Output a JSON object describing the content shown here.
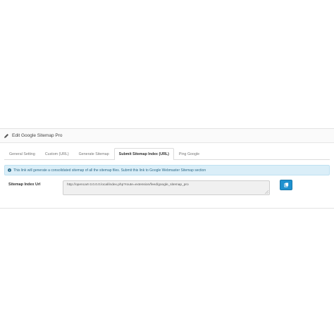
{
  "panel": {
    "title": "Edit Google Sitemap Pro"
  },
  "tabs": [
    {
      "label": "General Setting"
    },
    {
      "label": "Custom (URL)"
    },
    {
      "label": "Generate Sitemap"
    },
    {
      "label": "Submit Sitemap Index (URL)",
      "active": true
    },
    {
      "label": "Ping Google"
    }
  ],
  "alert": {
    "text": "This link will generate a consolidated sitemap of all the sitemap files. Submit this link to Google Webmaster Sitemap section"
  },
  "form": {
    "label": "Sitemap Index Url",
    "value": "http://opencart-3.0.0.0.local/index.php?route=extension/feed/google_sitemap_pro"
  },
  "icons": {
    "heading": "pencil-icon",
    "alert": "info-icon",
    "button": "copy-icon"
  },
  "colors": {
    "accent": "#1e91cf",
    "alert_bg": "#daeef8",
    "alert_text": "#2c6a88"
  }
}
